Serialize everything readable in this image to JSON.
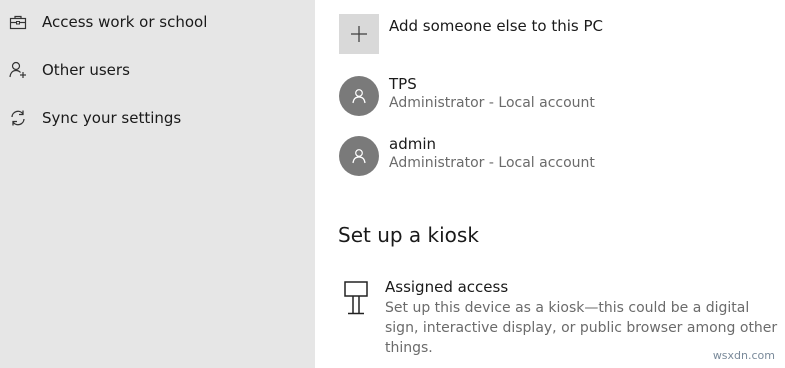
{
  "sidebar": {
    "items": [
      {
        "label": "Access work or school",
        "icon": "briefcase-icon"
      },
      {
        "label": "Other users",
        "icon": "add-person-icon"
      },
      {
        "label": "Sync your settings",
        "icon": "sync-icon"
      }
    ]
  },
  "main": {
    "add_user": {
      "label": "Add someone else to this PC",
      "icon": "plus-icon"
    },
    "users": [
      {
        "name": "TPS",
        "subtitle": "Administrator - Local account",
        "icon": "person-icon"
      },
      {
        "name": "admin",
        "subtitle": "Administrator - Local account",
        "icon": "person-icon"
      }
    ],
    "kiosk": {
      "section_title": "Set up a kiosk",
      "title": "Assigned access",
      "description": "Set up this device as a kiosk—this could be a digital sign, interactive display, or public browser among other things.",
      "icon": "kiosk-icon"
    }
  },
  "watermark": "wsxdn.com",
  "colors": {
    "sidebar_bg": "#e6e6e6",
    "avatar_bg": "#7a7a7a",
    "add_tile_bg": "#d9d9d9",
    "secondary_text": "#6b6b6b"
  }
}
